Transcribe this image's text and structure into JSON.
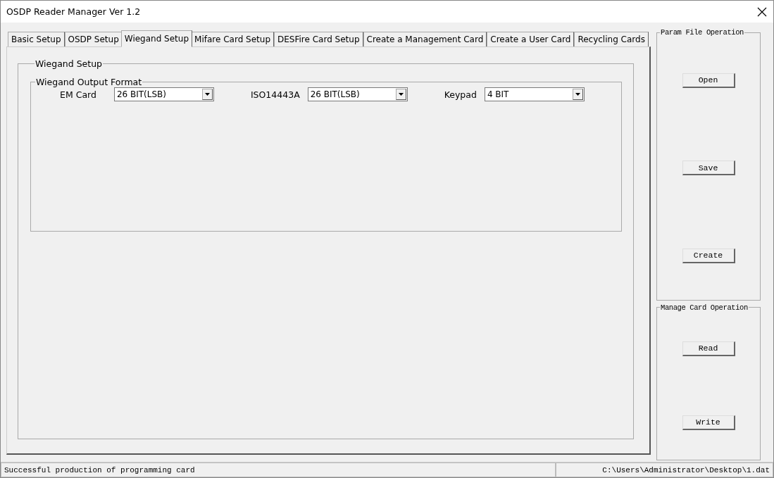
{
  "window": {
    "title": "OSDP Reader Manager Ver 1.2"
  },
  "tabs": [
    {
      "label": "Basic Setup",
      "selected": false
    },
    {
      "label": "OSDP Setup",
      "selected": false
    },
    {
      "label": "Wiegand Setup",
      "selected": true
    },
    {
      "label": "Mifare Card Setup",
      "selected": false
    },
    {
      "label": "DESFire Card Setup",
      "selected": false
    },
    {
      "label": "Create a Management Card",
      "selected": false
    },
    {
      "label": "Create a User Card",
      "selected": false
    },
    {
      "label": "Recycling Cards",
      "selected": false
    }
  ],
  "wiegand_setup": {
    "title": "Wiegand Setup",
    "output_format": {
      "title": "Wiegand Output Format",
      "fields": [
        {
          "label": "EM Card",
          "value": "26 BIT(LSB)"
        },
        {
          "label": "ISO14443A",
          "value": "26 BIT(LSB)"
        },
        {
          "label": "Keypad",
          "value": "4 BIT"
        }
      ]
    }
  },
  "side_groups": [
    {
      "title": "Param File Operation",
      "buttons": [
        "Open",
        "Save",
        "Create"
      ]
    },
    {
      "title": "Manage Card Operation",
      "buttons": [
        "Read",
        "Write"
      ]
    }
  ],
  "status_bar": {
    "message": "Successful production of programming card",
    "path": "C:\\Users\\Administrator\\Desktop\\1.dat"
  }
}
